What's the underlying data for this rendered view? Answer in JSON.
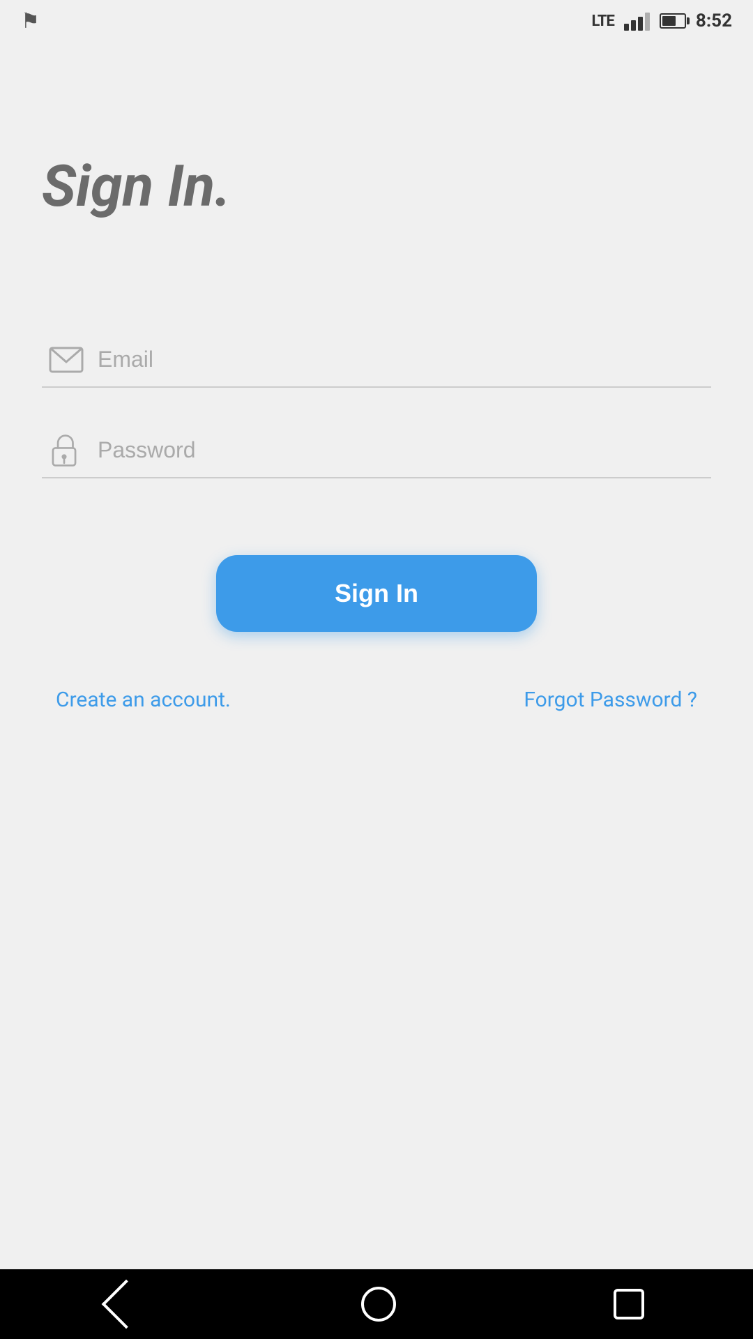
{
  "statusBar": {
    "time": "8:52",
    "lte": "LTE",
    "flag": "⚑"
  },
  "page": {
    "title": "Sign In.",
    "emailPlaceholder": "Email",
    "passwordPlaceholder": "Password",
    "signInButton": "Sign In",
    "createAccountLink": "Create an account.",
    "forgotPasswordLink": "Forgot Password ?"
  },
  "colors": {
    "accent": "#3d9be9",
    "titleColor": "#6b6b6b",
    "inputPlaceholder": "#aaa",
    "background": "#f0f0f0"
  }
}
